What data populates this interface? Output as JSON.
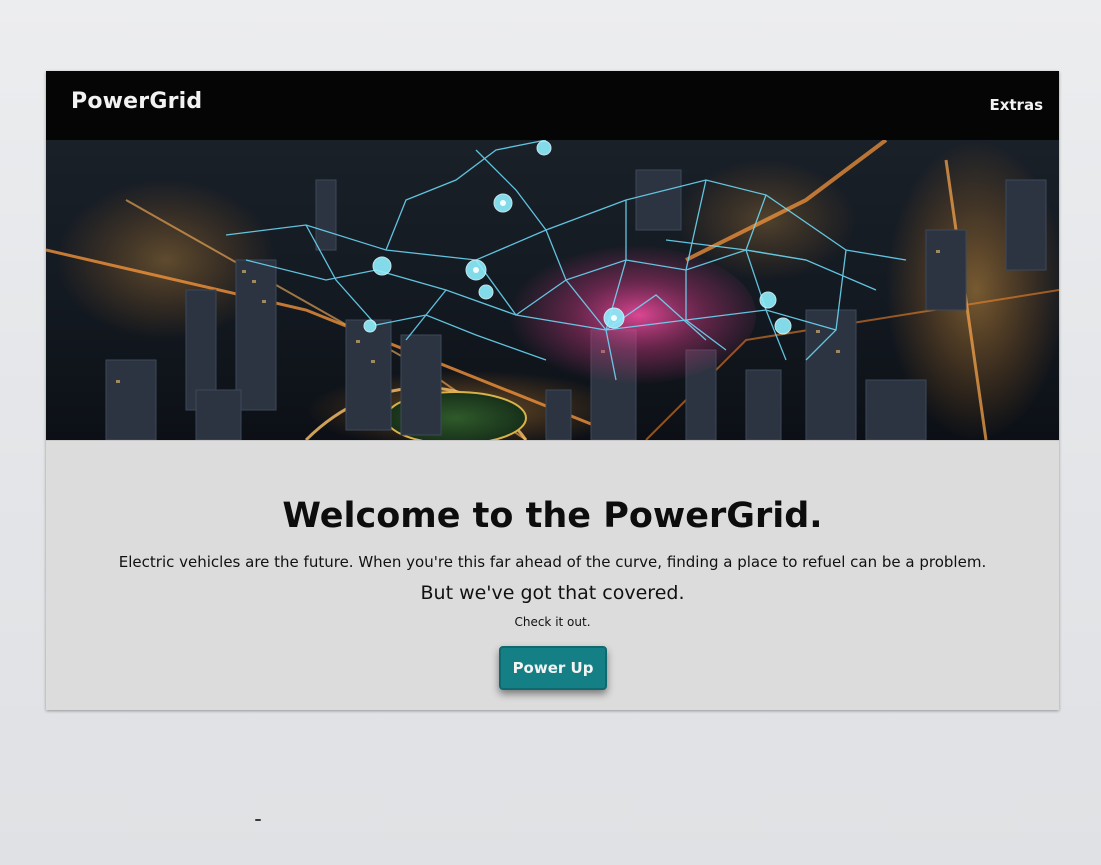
{
  "navbar": {
    "brand": "PowerGrid",
    "links": [
      "Extras"
    ]
  },
  "hero": {
    "image": "night city aerial with glowing network grid"
  },
  "main": {
    "headline": "Welcome to the PowerGrid.",
    "lede": "Electric vehicles are the future. When you're this far ahead of the curve, finding a place to refuel can be a problem.",
    "subhead": "But we've got that covered.",
    "small": "Check it out.",
    "cta_label": "Power Up"
  },
  "colors": {
    "navbar_bg": "#050505",
    "accent": "#157f86",
    "content_bg": "#dcdcdc"
  }
}
